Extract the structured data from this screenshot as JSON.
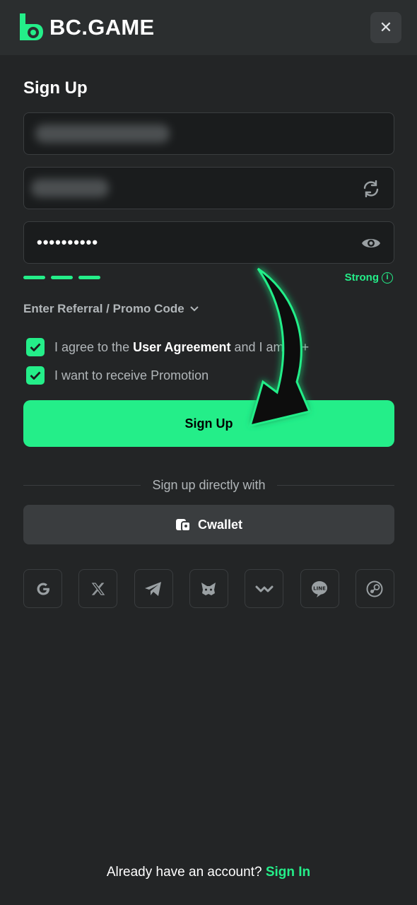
{
  "header": {
    "brand": "BC.GAME",
    "close_symbol": "✕"
  },
  "form": {
    "title": "Sign Up",
    "password_mask": "••••••••••",
    "strength_label": "Strong",
    "strength_info_symbol": "i",
    "referral_label": "Enter Referral / Promo Code",
    "agree_prefix": "I agree to the",
    "agree_link": "User Agreement",
    "agree_suffix": "and I am 18+",
    "promo_label": "I want to receive Promotion",
    "submit_label": "Sign Up"
  },
  "alt_signup": {
    "divider_text": "Sign up directly with",
    "cwallet_label": "Cwallet",
    "social_icons": [
      "google-icon",
      "x-icon",
      "telegram-icon",
      "metamask-icon",
      "walletconnect-icon",
      "line-icon",
      "steam-icon"
    ]
  },
  "footer": {
    "prompt": "Already have an account?",
    "signin_label": "Sign In"
  },
  "colors": {
    "accent": "#24ee89",
    "background": "#232526",
    "input_bg": "#1a1c1d"
  }
}
